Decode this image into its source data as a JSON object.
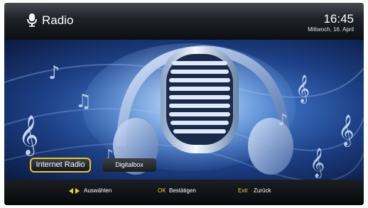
{
  "header": {
    "title": "Radio",
    "icon": "microphone-icon",
    "time": "16:45",
    "date": "Mittwoch, 16. April"
  },
  "tabs": [
    {
      "label": "Internet Radio",
      "selected": true
    },
    {
      "label": "Digitalbox",
      "selected": false
    }
  ],
  "footer": {
    "select_icon": "left-right-arrows-icon",
    "select_label": "Auswählen",
    "ok_key": "OK",
    "ok_label": "Bestätigen",
    "exit_key": "Exit",
    "exit_label": "Zurück"
  },
  "colors": {
    "accent": "#e8d23c",
    "selection_border": "#e8c63a",
    "background": "#0a0d14",
    "hero_blue": "#3b6fc0"
  }
}
